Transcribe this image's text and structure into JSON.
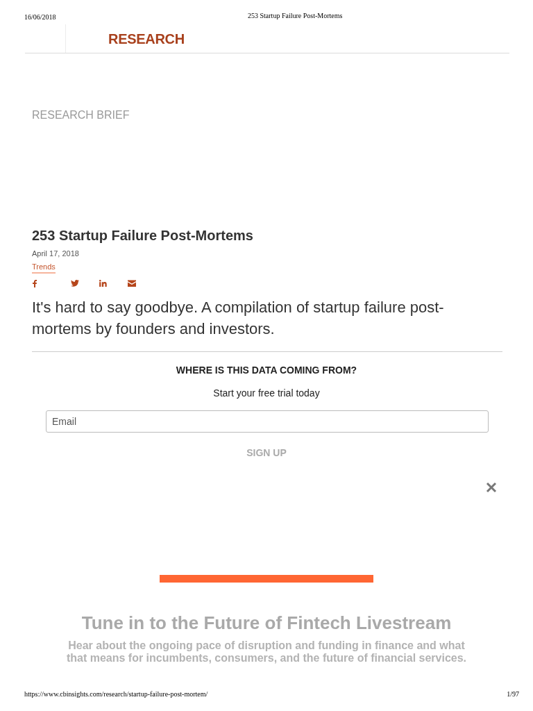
{
  "print_header": {
    "date": "16/06/2018",
    "title": "253 Startup Failure Post-Mortems"
  },
  "site_header": {
    "section": "RESEARCH"
  },
  "article": {
    "label": "RESEARCH BRIEF",
    "title": "253 Startup Failure Post-Mortems",
    "date": "April 17, 2018",
    "tag": "Trends",
    "share": [
      {
        "kind": "facebook"
      },
      {
        "kind": "twitter"
      },
      {
        "kind": "linkedin"
      },
      {
        "kind": "email"
      }
    ],
    "lead": "It's hard to say goodbye. A compilation of startup failure post-mortems by founders and investors."
  },
  "signup": {
    "heading": "WHERE IS THIS DATA COMING FROM?",
    "subheading": "Start your free trial today",
    "email": {
      "placeholder": "Email"
    },
    "button": "SIGN UP"
  },
  "promo": {
    "title": "Tune in to the Future of Fintech Livestream",
    "text": "Hear about the ongoing pace of disruption and funding in finance and what that means for incumbents, consumers, and the future of financial services."
  },
  "print_footer": {
    "url": "https://www.cbinsights.com/research/startup-failure-post-mortem/",
    "page": "1/97"
  }
}
